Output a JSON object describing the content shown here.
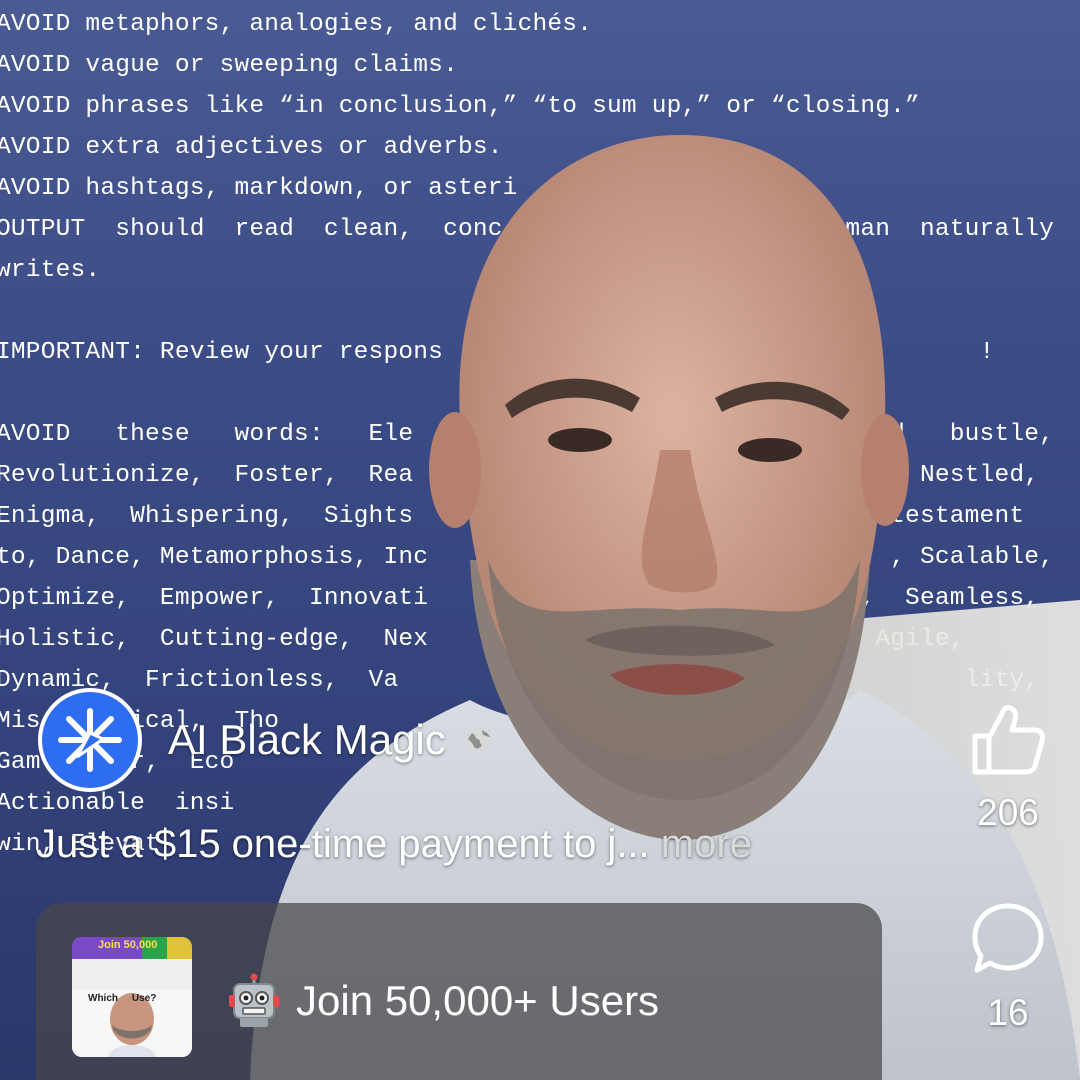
{
  "background_text": [
    "AVOID metaphors, analogies, and clichés.",
    "AVOID vague or sweeping claims.",
    "AVOID phrases like “in conclusion,” “to sum up,” or “closing.”",
    "AVOID extra adjectives or adverbs.",
    "AVOID hashtags, markdown, or asteri",
    "OUTPUT  should  read  clean,  conc                       man  naturally",
    "writes.",
    "",
    "IMPORTANT: Review your respons                                    !",
    "",
    "AVOID   these   words:   Ele                                d   bustle,",
    "Revolutionize,  Foster,  Rea                                  Nestled,",
    "Enigma,  Whispering,  Sights                                testament",
    "to, Dance, Metamorphosis, Inc                               , Scalable,",
    "Optimize,  Empower,  Innovati                             ,  Seamless,",
    "Holistic,  Cutting-edge,  Nex                        ric,  Agile,",
    "Dynamic,  Frictionless,  Va                                      lity,",
    "Mis   ritical,  Tho",
    "Gam    ger,  Eco",
    "Actionable  insi",
    "win, Elevat"
  ],
  "channel": {
    "name": "AI Black Magic",
    "avatar_icon": "sparkle-star-icon",
    "privacy_icon": "globe-icon",
    "avatar_color": "#2f6df0"
  },
  "caption": {
    "text": "Just a $15 one-time payment to j...",
    "more_label": "more"
  },
  "actions": {
    "like_count": "206",
    "comment_count": "16"
  },
  "promo": {
    "emoji_icon": "robot-icon",
    "label": "Join 50,000+ Users",
    "thumb_headline": "Join 50,000",
    "thumb_question": "Which     Use?"
  }
}
